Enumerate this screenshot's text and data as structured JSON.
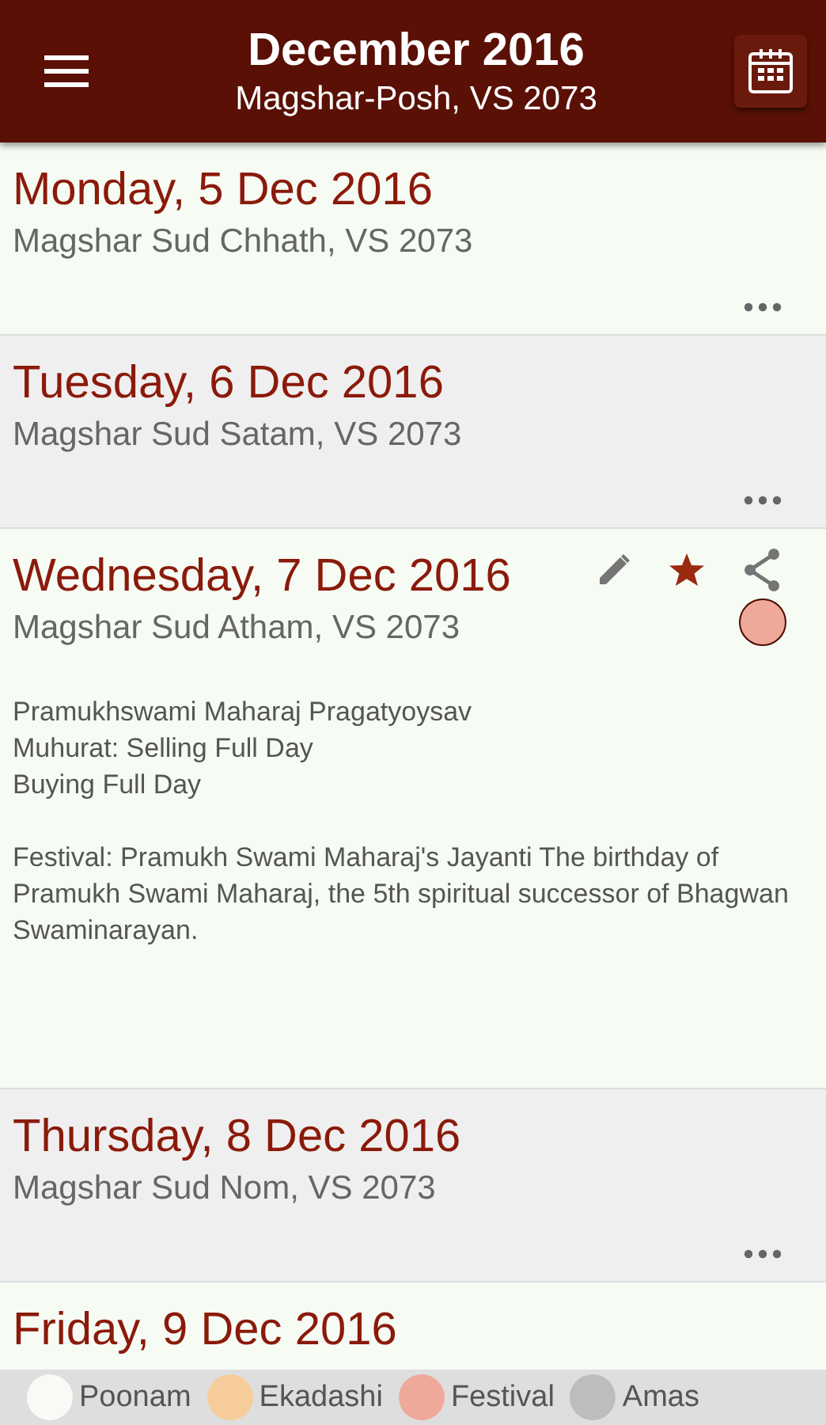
{
  "header": {
    "title": "December 2016",
    "subtitle": "Magshar-Posh, VS 2073"
  },
  "days": [
    {
      "date": "Monday, 5 Dec 2016",
      "tithi": "Magshar Sud Chhath, VS 2073",
      "expanded": false
    },
    {
      "date": "Tuesday, 6 Dec 2016",
      "tithi": "Magshar Sud Satam, VS 2073",
      "expanded": false
    },
    {
      "date": "Wednesday, 7 Dec 2016",
      "tithi": "Magshar Sud Atham, VS 2073",
      "expanded": true,
      "starred": true,
      "color": "#efa99a",
      "details": [
        [
          "Pramukhswami Maharaj Pragatyoysav",
          "Muhurat: Selling Full Day",
          "Buying Full Day"
        ],
        [
          "Festival: Pramukh Swami Maharaj's Jayanti The birthday of Pramukh Swami Maharaj, the 5th spiritual successor of Bhagwan Swaminarayan."
        ]
      ]
    },
    {
      "date": "Thursday, 8 Dec 2016",
      "tithi": "Magshar Sud Nom, VS 2073",
      "expanded": false
    },
    {
      "date": "Friday, 9 Dec 2016",
      "expanded": false
    }
  ],
  "legend": [
    {
      "label": "Poonam",
      "color": "#f7faf5"
    },
    {
      "label": "Ekadashi",
      "color": "#f6cc9a"
    },
    {
      "label": "Festival",
      "color": "#efa99a"
    },
    {
      "label": "Amas",
      "color": "#bdbdbd"
    }
  ]
}
